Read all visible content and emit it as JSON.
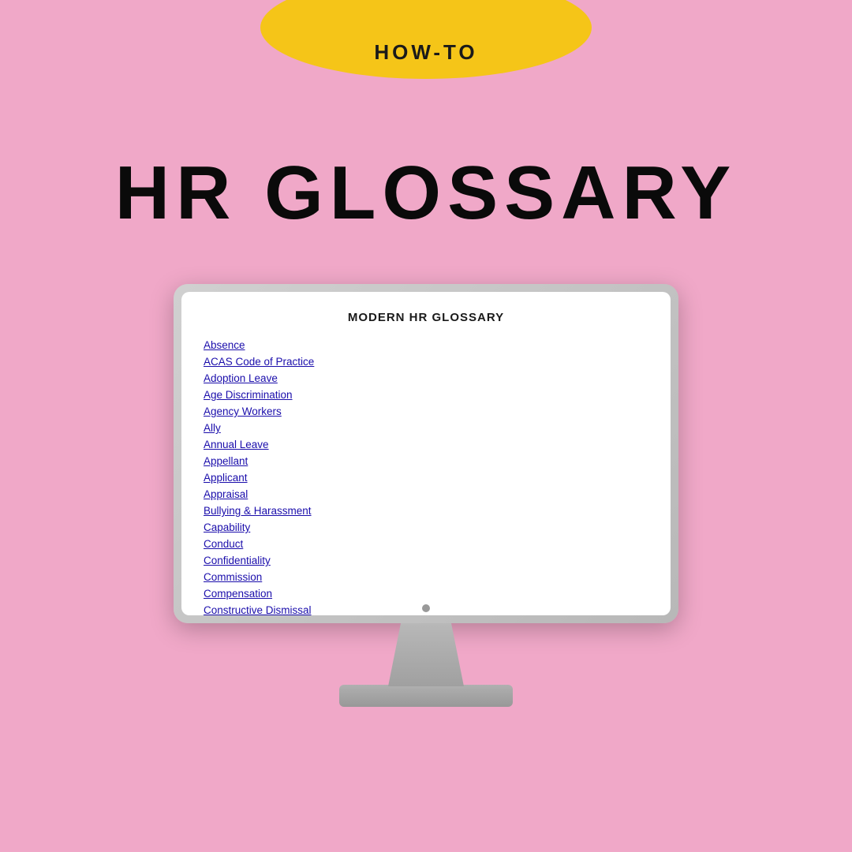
{
  "page": {
    "background_color": "#f0a8c8",
    "pill_label": "HOW-TO",
    "main_heading": "HR GLOSSARY",
    "monitor": {
      "screen_title": "MODERN HR GLOSSARY",
      "glossary_items": [
        "Absence",
        "ACAS Code of Practice",
        "Adoption Leave",
        "Age Discrimination",
        "Agency Workers",
        "Ally",
        "Annual Leave",
        "Appellant",
        "Applicant",
        "Appraisal",
        "Bullying & Harassment",
        "Capability",
        "Conduct",
        "Confidentiality",
        "Commission",
        "Compensation",
        "Constructive Dismissal"
      ]
    }
  }
}
